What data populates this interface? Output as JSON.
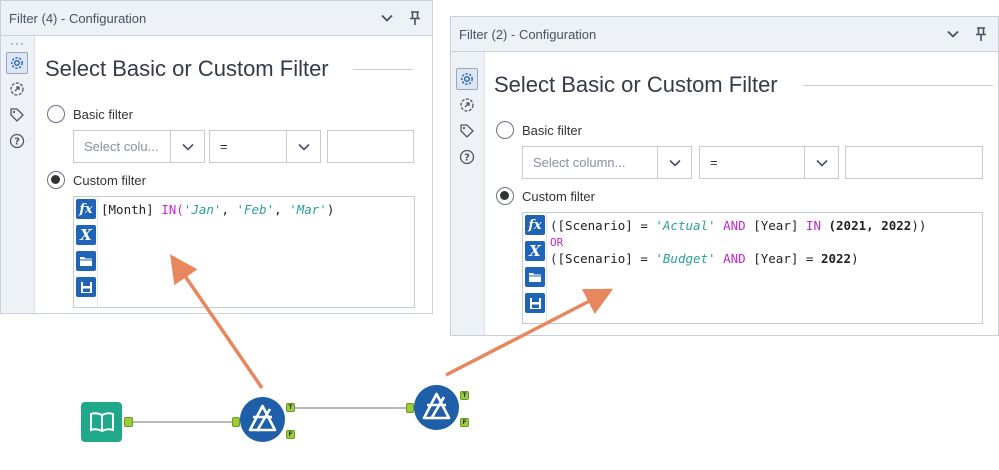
{
  "panel_left": {
    "title": "Filter (4) - Configuration",
    "heading": "Select Basic or Custom Filter",
    "basic_label": "Basic filter",
    "column_placeholder": "Select colu...",
    "operator": "=",
    "custom_label": "Custom filter",
    "expression": {
      "field": "[Month]",
      "keyword": "IN(",
      "v1": "'Jan'",
      "comma": ", ",
      "v2": "'Feb'",
      "v3": "'Mar'",
      "close": ")"
    }
  },
  "panel_right": {
    "title": "Filter (2) - Configuration",
    "heading": "Select Basic or Custom Filter",
    "basic_label": "Basic filter",
    "column_placeholder": "Select column...",
    "operator": "=",
    "custom_label": "Custom filter",
    "expression": {
      "open": "(",
      "scenario": "[Scenario]",
      "eq": " = ",
      "actual": "'Actual'",
      "and": " AND ",
      "year": "[Year]",
      "in": " IN ",
      "years_open": "(",
      "y2021": "2021",
      "comma": ", ",
      "y2022": "2022",
      "close_list": "))",
      "or": "OR",
      "budget": "'Budget'",
      "close": ")"
    }
  },
  "workflow": {
    "anchor_true": "T",
    "anchor_false": "F"
  },
  "colors": {
    "tool_blue": "#1f5ea8",
    "input_green": "#1fa98a",
    "arrow_orange": "#e8875d",
    "anchor_green": "#9ccc3c"
  },
  "icons": [
    "chevron-down-icon",
    "pin-icon",
    "gear-icon",
    "connection-icon",
    "tag-icon",
    "help-icon",
    "function-icon",
    "variable-icon",
    "open-folder-icon",
    "save-icon",
    "book-icon",
    "filter-icon"
  ]
}
